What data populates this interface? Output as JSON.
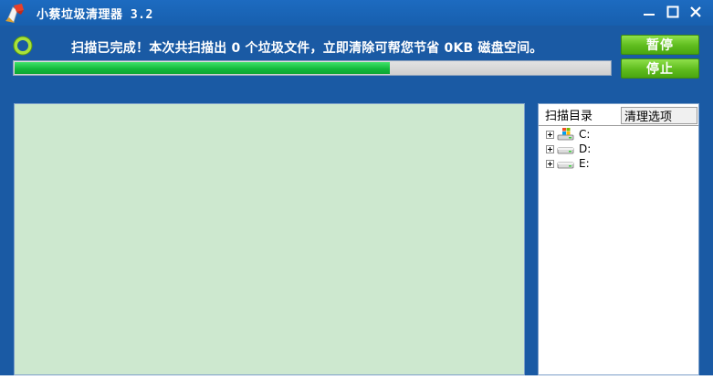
{
  "window": {
    "title": "小蔡垃圾清理器 3.2",
    "controls": {
      "minimize": "minimize-icon",
      "maximize": "maximize-icon",
      "close": "close-icon"
    }
  },
  "status": {
    "icon": "ring-status-icon",
    "message": "扫描已完成！本次共扫描出 0 个垃圾文件，立即清除可帮您节省 0KB 磁盘空间。"
  },
  "progress": {
    "fraction": 0.63
  },
  "buttons": {
    "pause": "暂停",
    "stop": "停止"
  },
  "panel": {
    "tabs": [
      {
        "label": "扫描目录",
        "active": true
      },
      {
        "label": "清理选项",
        "active": false
      }
    ],
    "drives": [
      {
        "label": "C:",
        "icon": "system-drive-icon"
      },
      {
        "label": "D:",
        "icon": "hard-drive-icon"
      },
      {
        "label": "E:",
        "icon": "hard-drive-icon"
      }
    ]
  },
  "colors": {
    "window_bg": "#1a5aa4",
    "progress_fill": "#10b73a",
    "button_green": "#5fbc1e",
    "result_bg": "#cde8cf"
  }
}
